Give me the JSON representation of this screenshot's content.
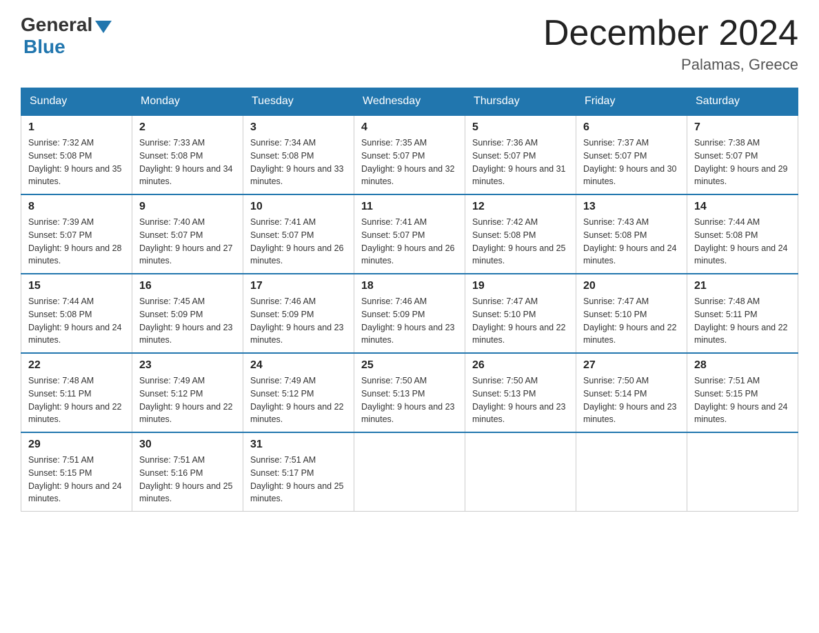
{
  "logo": {
    "general": "General",
    "blue": "Blue"
  },
  "title": "December 2024",
  "subtitle": "Palamas, Greece",
  "days": [
    "Sunday",
    "Monday",
    "Tuesday",
    "Wednesday",
    "Thursday",
    "Friday",
    "Saturday"
  ],
  "weeks": [
    [
      {
        "num": "1",
        "sunrise": "7:32 AM",
        "sunset": "5:08 PM",
        "daylight": "9 hours and 35 minutes."
      },
      {
        "num": "2",
        "sunrise": "7:33 AM",
        "sunset": "5:08 PM",
        "daylight": "9 hours and 34 minutes."
      },
      {
        "num": "3",
        "sunrise": "7:34 AM",
        "sunset": "5:08 PM",
        "daylight": "9 hours and 33 minutes."
      },
      {
        "num": "4",
        "sunrise": "7:35 AM",
        "sunset": "5:07 PM",
        "daylight": "9 hours and 32 minutes."
      },
      {
        "num": "5",
        "sunrise": "7:36 AM",
        "sunset": "5:07 PM",
        "daylight": "9 hours and 31 minutes."
      },
      {
        "num": "6",
        "sunrise": "7:37 AM",
        "sunset": "5:07 PM",
        "daylight": "9 hours and 30 minutes."
      },
      {
        "num": "7",
        "sunrise": "7:38 AM",
        "sunset": "5:07 PM",
        "daylight": "9 hours and 29 minutes."
      }
    ],
    [
      {
        "num": "8",
        "sunrise": "7:39 AM",
        "sunset": "5:07 PM",
        "daylight": "9 hours and 28 minutes."
      },
      {
        "num": "9",
        "sunrise": "7:40 AM",
        "sunset": "5:07 PM",
        "daylight": "9 hours and 27 minutes."
      },
      {
        "num": "10",
        "sunrise": "7:41 AM",
        "sunset": "5:07 PM",
        "daylight": "9 hours and 26 minutes."
      },
      {
        "num": "11",
        "sunrise": "7:41 AM",
        "sunset": "5:07 PM",
        "daylight": "9 hours and 26 minutes."
      },
      {
        "num": "12",
        "sunrise": "7:42 AM",
        "sunset": "5:08 PM",
        "daylight": "9 hours and 25 minutes."
      },
      {
        "num": "13",
        "sunrise": "7:43 AM",
        "sunset": "5:08 PM",
        "daylight": "9 hours and 24 minutes."
      },
      {
        "num": "14",
        "sunrise": "7:44 AM",
        "sunset": "5:08 PM",
        "daylight": "9 hours and 24 minutes."
      }
    ],
    [
      {
        "num": "15",
        "sunrise": "7:44 AM",
        "sunset": "5:08 PM",
        "daylight": "9 hours and 24 minutes."
      },
      {
        "num": "16",
        "sunrise": "7:45 AM",
        "sunset": "5:09 PM",
        "daylight": "9 hours and 23 minutes."
      },
      {
        "num": "17",
        "sunrise": "7:46 AM",
        "sunset": "5:09 PM",
        "daylight": "9 hours and 23 minutes."
      },
      {
        "num": "18",
        "sunrise": "7:46 AM",
        "sunset": "5:09 PM",
        "daylight": "9 hours and 23 minutes."
      },
      {
        "num": "19",
        "sunrise": "7:47 AM",
        "sunset": "5:10 PM",
        "daylight": "9 hours and 22 minutes."
      },
      {
        "num": "20",
        "sunrise": "7:47 AM",
        "sunset": "5:10 PM",
        "daylight": "9 hours and 22 minutes."
      },
      {
        "num": "21",
        "sunrise": "7:48 AM",
        "sunset": "5:11 PM",
        "daylight": "9 hours and 22 minutes."
      }
    ],
    [
      {
        "num": "22",
        "sunrise": "7:48 AM",
        "sunset": "5:11 PM",
        "daylight": "9 hours and 22 minutes."
      },
      {
        "num": "23",
        "sunrise": "7:49 AM",
        "sunset": "5:12 PM",
        "daylight": "9 hours and 22 minutes."
      },
      {
        "num": "24",
        "sunrise": "7:49 AM",
        "sunset": "5:12 PM",
        "daylight": "9 hours and 22 minutes."
      },
      {
        "num": "25",
        "sunrise": "7:50 AM",
        "sunset": "5:13 PM",
        "daylight": "9 hours and 23 minutes."
      },
      {
        "num": "26",
        "sunrise": "7:50 AM",
        "sunset": "5:13 PM",
        "daylight": "9 hours and 23 minutes."
      },
      {
        "num": "27",
        "sunrise": "7:50 AM",
        "sunset": "5:14 PM",
        "daylight": "9 hours and 23 minutes."
      },
      {
        "num": "28",
        "sunrise": "7:51 AM",
        "sunset": "5:15 PM",
        "daylight": "9 hours and 24 minutes."
      }
    ],
    [
      {
        "num": "29",
        "sunrise": "7:51 AM",
        "sunset": "5:15 PM",
        "daylight": "9 hours and 24 minutes."
      },
      {
        "num": "30",
        "sunrise": "7:51 AM",
        "sunset": "5:16 PM",
        "daylight": "9 hours and 25 minutes."
      },
      {
        "num": "31",
        "sunrise": "7:51 AM",
        "sunset": "5:17 PM",
        "daylight": "9 hours and 25 minutes."
      },
      null,
      null,
      null,
      null
    ]
  ]
}
